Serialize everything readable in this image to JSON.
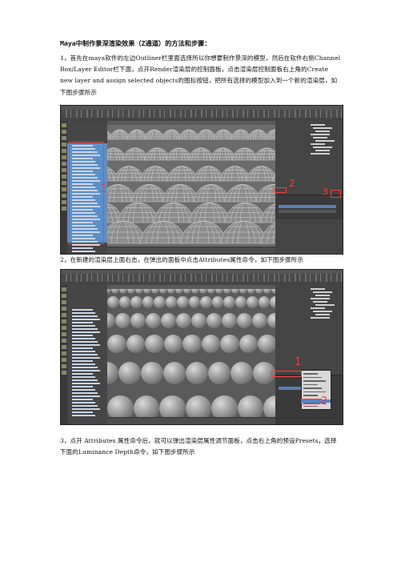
{
  "doc": {
    "title": "Maya中制作景深渲染效果（Z通道）的方法和步骤：",
    "paragraphs": [
      "1，首先在maya软件的左边Outliner栏里面选择所以你想要制作景深的模型，然后在软件右侧Channel Box/Layer Editor栏下面，点开Render渲染层的控制面板，点击渲染层控制面板右上角的Create new layer and assign selected objects的图标按钮，把所有选择的模型加入到一个新的渲染层，如下图步骤所示",
      "2，在新建的渲染层上面右击，在弹出的面板中点击Attributes属性命令，如下图步骤所示",
      "3，点开 Attributes 属性命令后，就可以弹出渲染层属性调节面板，点击右上角的预设Presets，选择下面的Luminance Depth命令，如下图步骤所示"
    ]
  },
  "screenshot1": {
    "markers": [
      "1",
      "2",
      "3"
    ],
    "colors": {
      "marker": "#ff3b3b",
      "mesh": "#c8c8c8",
      "selection": "#6f9fd8"
    }
  },
  "screenshot2": {
    "markers": [
      "1",
      "2"
    ],
    "colors": {
      "marker": "#ff3b3b",
      "sphere": "#9a9a9a"
    }
  }
}
